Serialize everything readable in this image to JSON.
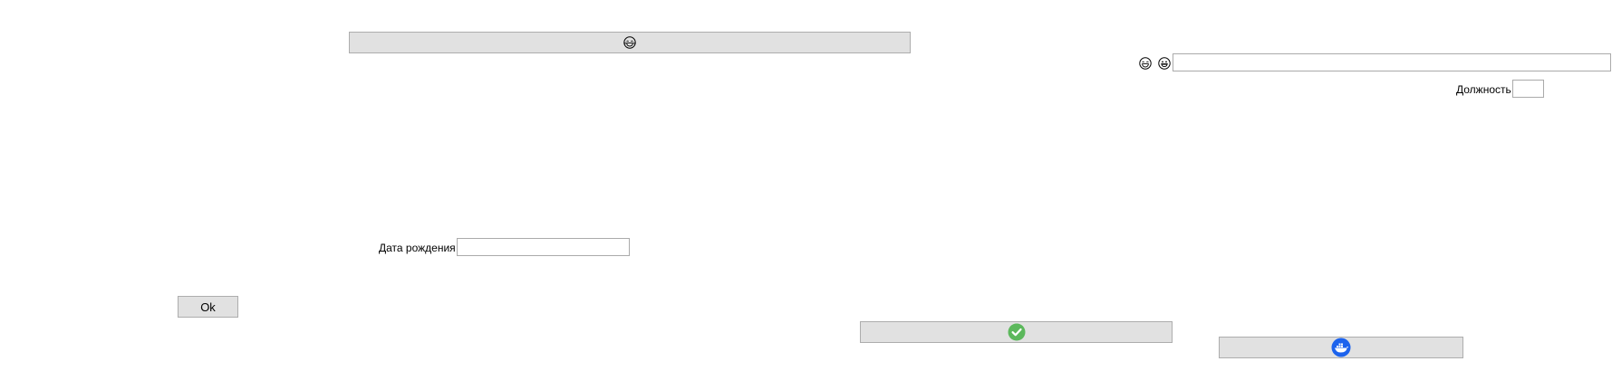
{
  "form": {
    "top_button": {
      "icon": "face-with-tears-of-joy-icon"
    },
    "name_row": {
      "icons": [
        "face-with-tears-of-joy-icon",
        "grinning-face-icon"
      ],
      "value": ""
    },
    "position_label": "Должность",
    "position_value": "",
    "birth_date_label": "Дата рождения",
    "birth_date_value": "",
    "ok_label": "Ok",
    "confirm_button": {
      "icon": "check-circle-icon",
      "color": "#5cb85c"
    },
    "dock_button": {
      "icon": "docker-whale-icon",
      "color": "#1d63ed"
    }
  }
}
